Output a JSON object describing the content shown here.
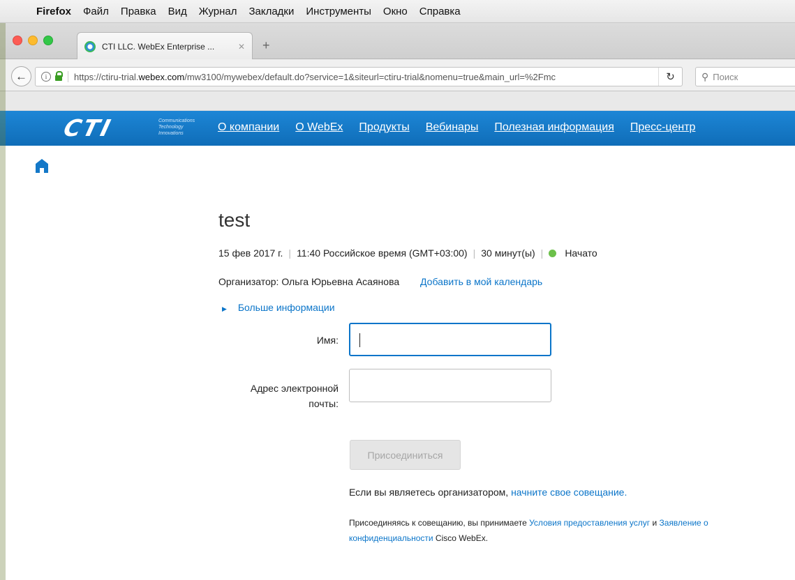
{
  "menubar": {
    "app": "Firefox",
    "items": [
      "Файл",
      "Правка",
      "Вид",
      "Журнал",
      "Закладки",
      "Инструменты",
      "Окно",
      "Справка"
    ]
  },
  "browser": {
    "tab_title": "CTI LLC. WebEx Enterprise ...",
    "url_prefix": "https://ctiru-trial.",
    "url_domain": "webex.com",
    "url_suffix": "/mw3100/mywebex/default.do?service=1&siteurl=ctiru-trial&nomenu=true&main_url=%2Fmc",
    "search_placeholder": "Поиск"
  },
  "site": {
    "logo_text": "CTI",
    "logo_tagline": [
      "Communications",
      "Technology",
      "Innovations"
    ],
    "nav": [
      "О компании",
      "О WebEx",
      "Продукты",
      "Вебинары",
      "Полезная информация",
      "Пресс-центр"
    ],
    "accent": "#1478c8"
  },
  "meeting": {
    "title": "test",
    "date": "15 фев 2017 г.",
    "time": "11:40 Российское время (GMT+03:00)",
    "duration": "30 минут(ы)",
    "status": "Начато",
    "status_color": "#6cc04a",
    "host_label": "Организатор: Ольга Юрьевна Асаянова",
    "add_calendar": "Добавить в мой календарь",
    "more_info": "Больше информации"
  },
  "form": {
    "name_label": "Имя:",
    "name_value": "",
    "email_label_line1": "Адрес электронной",
    "email_label_line2": "почты:",
    "email_value": "",
    "join_button": "Присоединиться"
  },
  "footer": {
    "host_text": "Если вы являетесь организатором,",
    "host_link": "начните свое совещание.",
    "terms_prefix": "Присоединяясь к совещанию, вы принимаете",
    "terms_link1": "Условия предоставления услуг",
    "terms_and": "и",
    "terms_link2a": "Заявление о",
    "terms_link2b": "конфиденциальности",
    "terms_suffix": "Cisco WebEx."
  }
}
